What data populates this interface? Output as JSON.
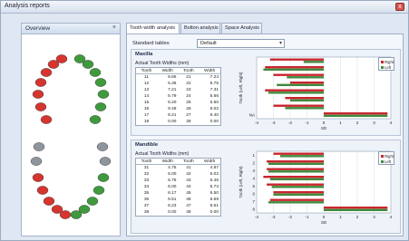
{
  "window": {
    "title": "Analysis reports",
    "close_glyph": "x"
  },
  "overview": {
    "title": "Overview",
    "pin_glyph": "×"
  },
  "tabs": [
    {
      "label": "Tooth width analysis",
      "active": true
    },
    {
      "label": "Bolton analysis",
      "active": false
    },
    {
      "label": "Space Analysis",
      "active": false
    }
  ],
  "standard_tables": {
    "label": "Standard tables",
    "value": "Default"
  },
  "colors": {
    "right": "#c8252c",
    "left": "#3f8a3c",
    "red_tooth": "#d6342f",
    "green_tooth": "#3f9a3e",
    "grey_tooth": "#8f959c"
  },
  "maxilla": {
    "title": "Maxilla",
    "table_title": "Actual Tooth Widths (mm)",
    "headers": [
      "Tooth",
      "Width",
      "Tooth",
      "Width"
    ],
    "rows": [
      [
        "11",
        "8.65",
        "21",
        "7.24"
      ],
      [
        "12",
        "5.36",
        "22",
        "5.75"
      ],
      [
        "13",
        "7.21",
        "23",
        "7.31"
      ],
      [
        "14",
        "5.79",
        "24",
        "5.66"
      ],
      [
        "15",
        "6.20",
        "25",
        "5.60"
      ],
      [
        "16",
        "9.48",
        "26",
        "9.02"
      ],
      [
        "17",
        "8.21",
        "27",
        "8.40"
      ],
      [
        "18",
        "0.00",
        "28",
        "0.00"
      ]
    ],
    "legend": {
      "right": "Right",
      "left": "Left"
    }
  },
  "mandible": {
    "title": "Mandible",
    "table_title": "Actual Tooth Widths (mm)",
    "headers": [
      "Tooth",
      "Width",
      "Tooth",
      "Width"
    ],
    "rows": [
      [
        "31",
        "4.75",
        "41",
        "4.97"
      ],
      [
        "32",
        "5.00",
        "42",
        "5.02"
      ],
      [
        "33",
        "5.75",
        "43",
        "5.46"
      ],
      [
        "34",
        "6.00",
        "44",
        "5.73"
      ],
      [
        "35",
        "6.17",
        "45",
        "6.50"
      ],
      [
        "36",
        "9.51",
        "46",
        "9.69"
      ],
      [
        "37",
        "8.23",
        "47",
        "8.61"
      ],
      [
        "38",
        "0.00",
        "48",
        "0.00"
      ]
    ],
    "legend": {
      "right": "Right",
      "left": "Left"
    }
  },
  "chart_data": [
    {
      "type": "bar",
      "orientation": "horizontal",
      "ylabel": "Tooth (Left, Right)",
      "xlabel": "SD",
      "xlim": [
        -4,
        4
      ],
      "x_ticks": [
        "-4",
        "-3",
        "-2",
        "-1",
        "0",
        "1",
        "2",
        "3",
        "4"
      ],
      "y_tick_labels": [
        "",
        "",
        "",
        "",
        "",
        "",
        "",
        "NA"
      ],
      "series": [
        {
          "name": "Right",
          "values": [
            -3.2,
            -3.5,
            -3.0,
            -2.0,
            -3.5,
            -2.3,
            -3.0,
            3.8
          ]
        },
        {
          "name": "Left",
          "values": [
            -1.2,
            -3.6,
            -2.2,
            -2.8,
            -3.3,
            -2.0,
            -2.3,
            3.8
          ]
        }
      ]
    },
    {
      "type": "bar",
      "orientation": "horizontal",
      "ylabel": "Tooth (Left, Right)",
      "xlabel": "SD",
      "xlim": [
        -4,
        4
      ],
      "x_ticks": [
        "-4",
        "-3",
        "-2",
        "-1",
        "0",
        "1",
        "2",
        "3",
        "4"
      ],
      "y_tick_labels": [
        "1",
        "2",
        "3",
        "4",
        "5",
        "6",
        "7",
        "8"
      ],
      "series": [
        {
          "name": "Right",
          "values": [
            -3.0,
            -3.4,
            -3.4,
            -3.6,
            -3.4,
            -3.0,
            -3.2,
            3.8
          ]
        },
        {
          "name": "Left",
          "values": [
            -2.6,
            -3.3,
            -3.3,
            -3.2,
            -3.1,
            -3.0,
            -3.3,
            3.8
          ]
        }
      ]
    }
  ]
}
